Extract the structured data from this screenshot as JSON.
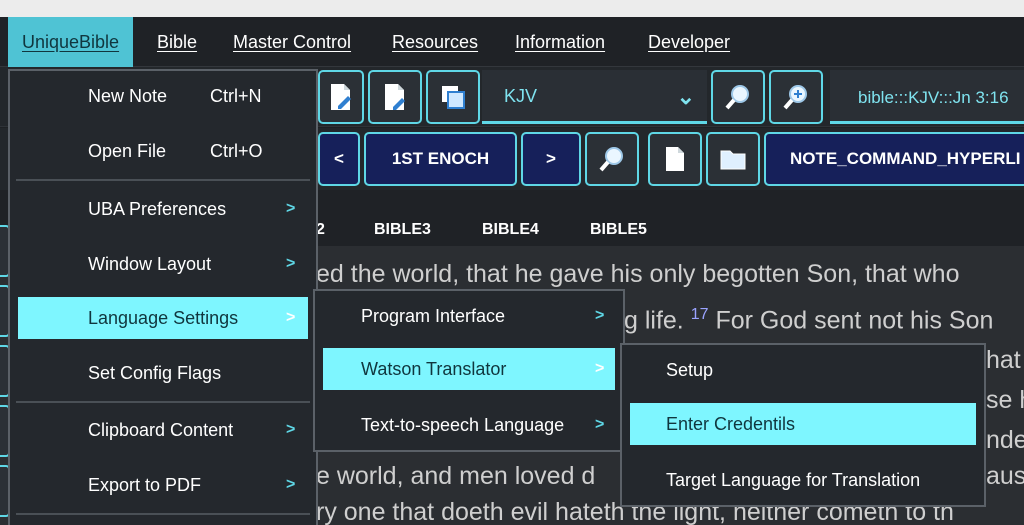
{
  "menubar": {
    "items": [
      {
        "label": "UniqueBible"
      },
      {
        "label": "Bible"
      },
      {
        "label": "Master Control"
      },
      {
        "label": "Resources"
      },
      {
        "label": "Information"
      },
      {
        "label": "Developer"
      }
    ]
  },
  "toolbar1": {
    "version_combo_value": "KJV",
    "reference_value": "bible:::KJV:::Jn 3:16"
  },
  "toolbar2": {
    "prev_label": "<",
    "book_label": "1ST ENOCH",
    "next_label": ">",
    "note_command_label": "NOTE_COMMAND_HYPERLI"
  },
  "tabs": {
    "partial_first": "2",
    "items": [
      "BIBLE3",
      "BIBLE4",
      "BIBLE5"
    ]
  },
  "bible_text": {
    "line1": "ed the world, that he gave his only begotten Son, that who",
    "line2_pre": "g life.",
    "verse17": "17",
    "line2_post": "For God sent not his Son",
    "line3_frag": "hat",
    "line4_frag": "se h",
    "line5_frag": "nde",
    "line6_pre": "e world, and men loved d",
    "line6_post": "aus",
    "line7": "ry one that doeth evil hateth the light, neither cometh to th"
  },
  "menu_main": {
    "items": [
      {
        "label": "New Note",
        "shortcut": "Ctrl+N"
      },
      {
        "label": "Open File",
        "shortcut": "Ctrl+O"
      },
      {
        "label": "UBA Preferences",
        "arrow": ">"
      },
      {
        "label": "Window Layout",
        "arrow": ">"
      },
      {
        "label": "Language Settings",
        "arrow": ">"
      },
      {
        "label": "Set Config Flags"
      },
      {
        "label": "Clipboard Content",
        "arrow": ">"
      },
      {
        "label": "Export to PDF",
        "arrow": ">"
      }
    ]
  },
  "menu_language": {
    "items": [
      {
        "label": "Program Interface",
        "arrow": ">"
      },
      {
        "label": "Watson Translator",
        "arrow": ">"
      },
      {
        "label": "Text-to-speech Language",
        "arrow": ">"
      }
    ]
  },
  "menu_watson": {
    "items": [
      {
        "label": "Setup"
      },
      {
        "label": "Enter Credentils"
      },
      {
        "label": "Target Language for Translation"
      }
    ]
  }
}
